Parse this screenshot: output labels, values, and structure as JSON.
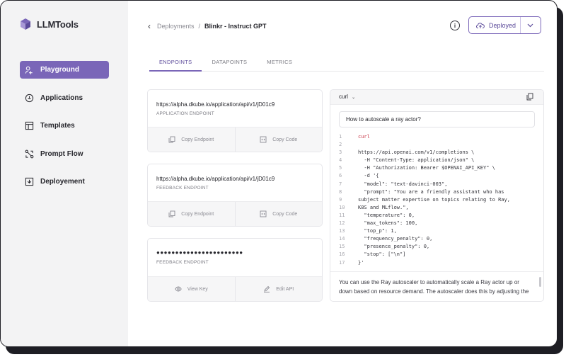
{
  "app": {
    "name": "LLMTools"
  },
  "sidebar": {
    "items": [
      {
        "label": "Playground",
        "icon": "playground-icon",
        "active": true
      },
      {
        "label": "Applications",
        "icon": "applications-icon",
        "active": false
      },
      {
        "label": "Templates",
        "icon": "templates-icon",
        "active": false
      },
      {
        "label": "Prompt Flow",
        "icon": "prompt-flow-icon",
        "active": false
      },
      {
        "label": "Deployement",
        "icon": "deployment-icon",
        "active": false
      }
    ]
  },
  "breadcrumb": {
    "parent": "Deployments",
    "separator": "/",
    "current": "Blinkr - Instruct GPT"
  },
  "header": {
    "deploy_label": "Deployed",
    "info_glyph": "i"
  },
  "tabs": [
    {
      "label": "ENDPOINTS",
      "active": true
    },
    {
      "label": "DATAPOINTS",
      "active": false
    },
    {
      "label": "METRICS",
      "active": false
    }
  ],
  "endpoints": [
    {
      "value": "https://alpha.dkube.io/application/api/v1/jD01c9",
      "caption": "APPLICATION ENDPOINT",
      "actions": [
        "Copy Endpoint",
        "Copy Code"
      ]
    },
    {
      "value": "https://alpha.dkube.io/application/api/v1/jD01c9",
      "caption": "FEEDBACK ENDPOINT",
      "actions": [
        "Copy Endpoint",
        "Copy Code"
      ]
    },
    {
      "value": "●●●●●●●●●●●●●●●●●●●●●●●",
      "caption": "FEEDBACK ENDPOINT",
      "actions": [
        "View Key",
        "Edit API"
      ]
    }
  ],
  "code_panel": {
    "language": "curl",
    "prompt": "How to autoscale a ray actor?",
    "lines": [
      "curl",
      "",
      "https://api.openai.com/v1/completions \\",
      "  -H \"Content-Type: application/json\" \\",
      "  -H \"Authorization: Bearer $OPENAI_API_KEY\" \\",
      "  -d '{",
      "  \"model\": \"text-davinci-003\",",
      "  \"prompt\": \"You are a friendly assistant who has",
      "subject matter expertise on topics relating to Ray,",
      "K8S and MLflow.\",",
      "  \"temperature\": 0,",
      "  \"max_tokens\": 100,",
      "  \"top_p\": 1,",
      "  \"frequency_penalty\": 0,",
      "  \"presence_penalty\": 0,",
      "  \"stop\": [\"\\n\"]",
      "}'"
    ],
    "line_numbers": [
      "1",
      "2",
      "3",
      "4",
      "5",
      "6",
      "7",
      "8",
      "9",
      "10",
      "11",
      "12",
      "13",
      "14",
      "15",
      "16",
      "17"
    ],
    "answer": "You can use the Ray autoscaler to automatically scale a Ray actor up or down based on resource demand. The autoscaler does this by adjusting the"
  },
  "colors": {
    "accent": "#7a66b8",
    "code_keyword": "#c93a4a"
  }
}
